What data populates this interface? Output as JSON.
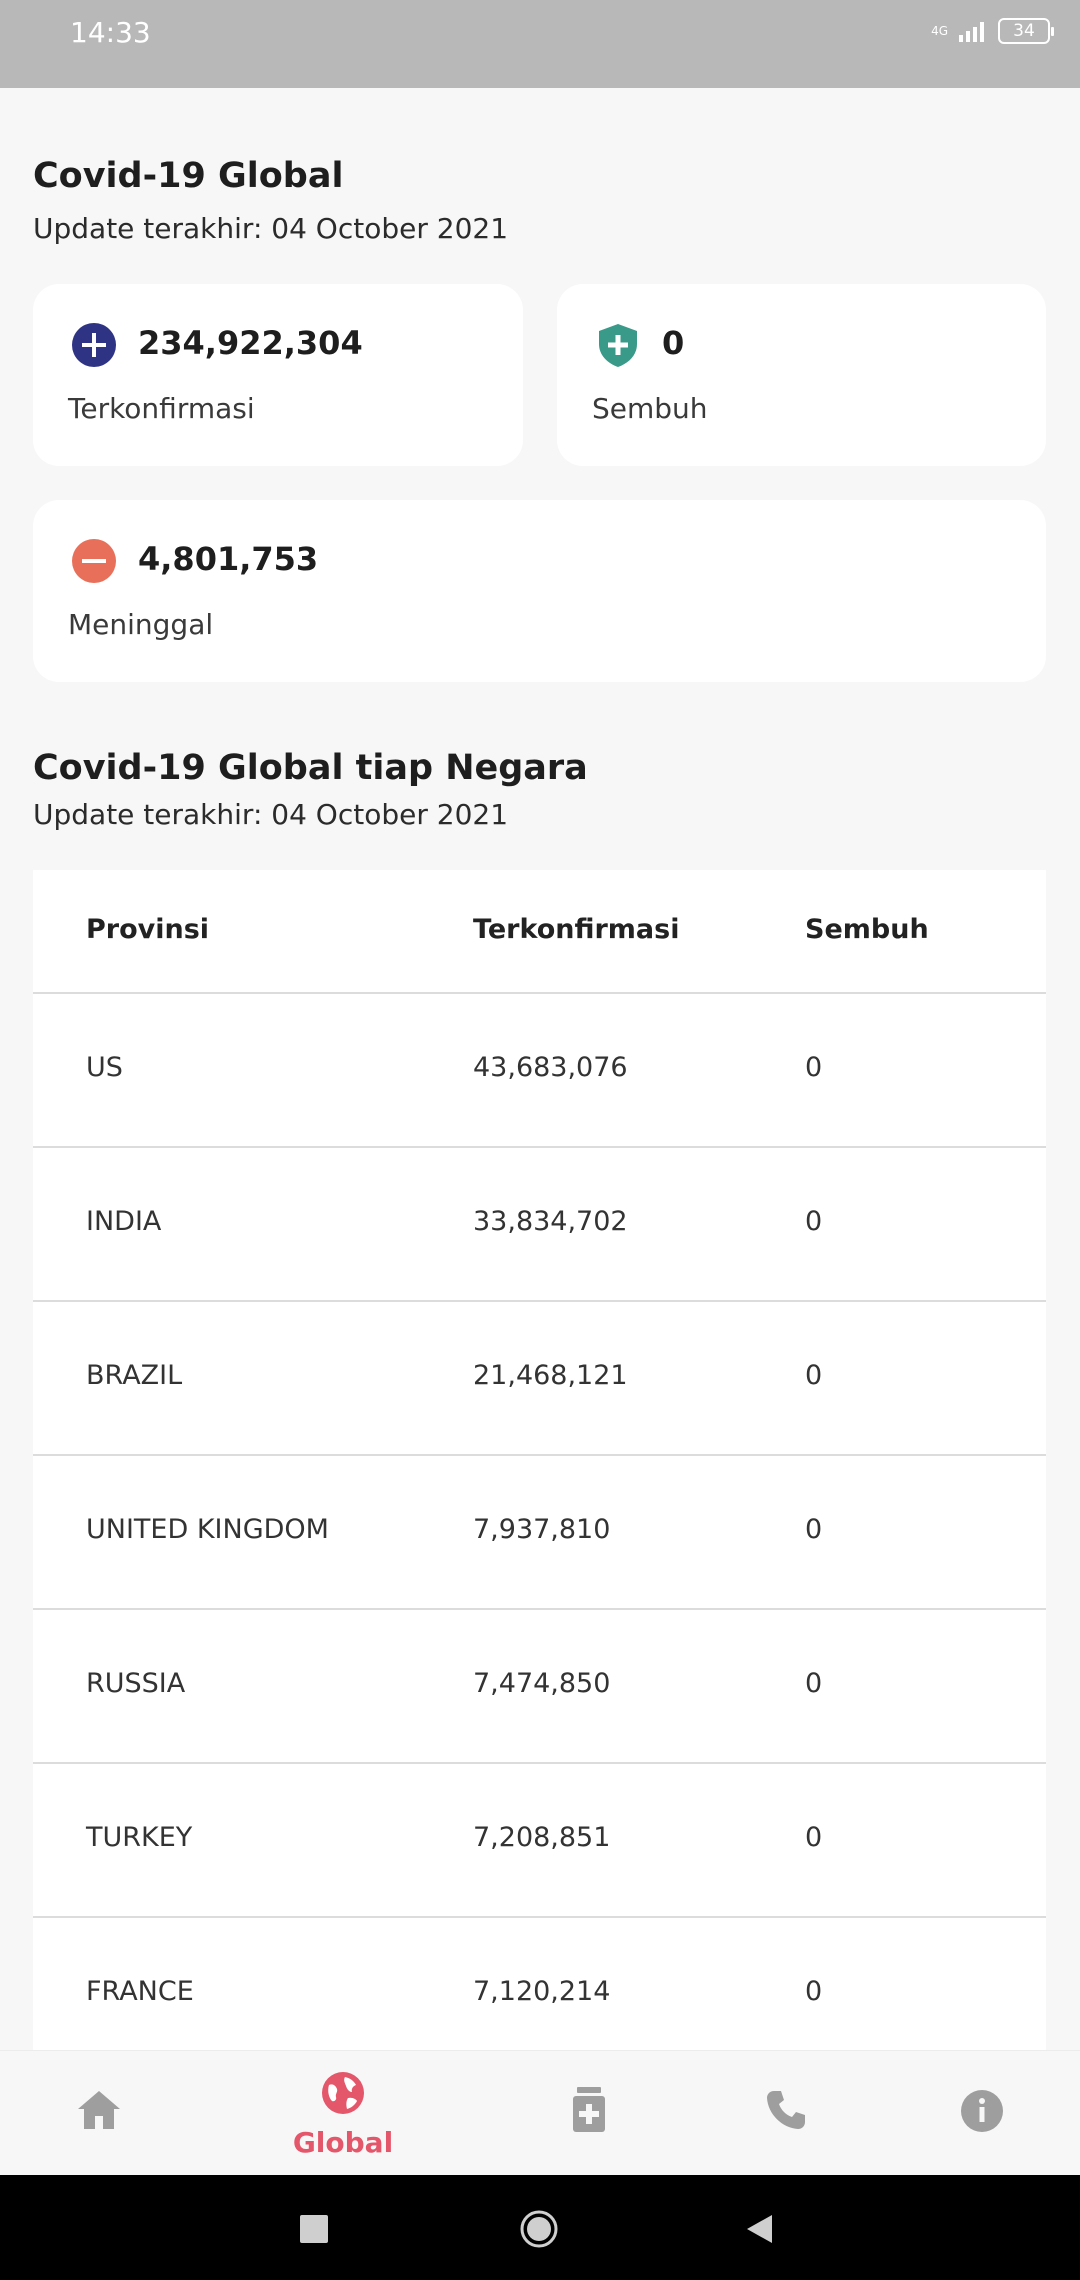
{
  "status_bar": {
    "time": "14:33",
    "network": "4G",
    "battery": "34"
  },
  "global": {
    "title": "Covid-19 Global",
    "updated": "Update terakhir: 04 October 2021",
    "confirmed": {
      "value": "234,922,304",
      "label": "Terkonfirmasi",
      "icon": "plus-circle-icon",
      "color": "#2e3384"
    },
    "recovered": {
      "value": "0",
      "label": "Sembuh",
      "icon": "shield-plus-icon",
      "color": "#3a9a8a"
    },
    "deaths": {
      "value": "4,801,753",
      "label": "Meninggal",
      "icon": "minus-circle-icon",
      "color": "#e8705a"
    }
  },
  "countries": {
    "title": "Covid-19 Global tiap Negara",
    "updated": "Update terakhir: 04 October 2021",
    "headers": [
      "Provinsi",
      "Terkonfirmasi",
      "Sembuh"
    ],
    "rows": [
      [
        "US",
        "43,683,076",
        "0"
      ],
      [
        "INDIA",
        "33,834,702",
        "0"
      ],
      [
        "BRAZIL",
        "21,468,121",
        "0"
      ],
      [
        "UNITED KINGDOM",
        "7,937,810",
        "0"
      ],
      [
        "RUSSIA",
        "7,474,850",
        "0"
      ],
      [
        "TURKEY",
        "7,208,851",
        "0"
      ],
      [
        "FRANCE",
        "7,120,214",
        "0"
      ]
    ]
  },
  "bottom_nav": {
    "items": [
      {
        "icon": "home-icon",
        "label": ""
      },
      {
        "icon": "globe-icon",
        "label": "Global",
        "active": true
      },
      {
        "icon": "medicine-icon",
        "label": ""
      },
      {
        "icon": "phone-icon",
        "label": ""
      },
      {
        "icon": "info-icon",
        "label": ""
      }
    ],
    "active_color": "#e4566a",
    "inactive_color": "#9e9e9e"
  }
}
